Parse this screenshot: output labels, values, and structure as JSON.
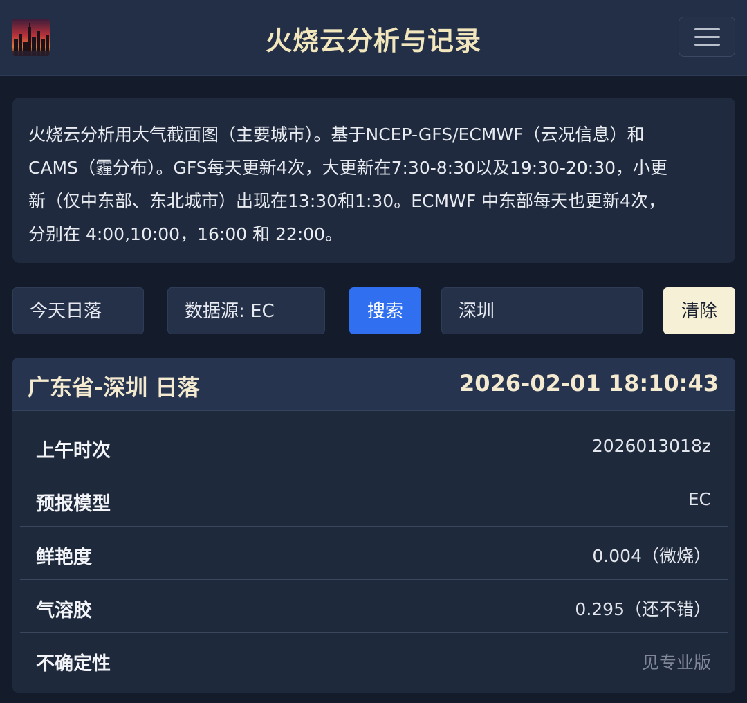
{
  "header": {
    "title": "火烧云分析与记录",
    "menu_icon": "hamburger-menu-icon",
    "logo_icon": "city-skyline-sunset-logo"
  },
  "description": {
    "line1": "火烧云分析用大气截面图（主要城市）。基于NCEP-GFS/ECMWF（云况信息）和",
    "line2": "CAMS（霾分布）。GFS每天更新4次，大更新在7:30-8:30以及19:30-20:30，小更",
    "line3": "新（仅中东部、东北城市）出现在13:30和1:30。ECMWF 中东部每天也更新4次，",
    "line4": "分别在 4:00,10:00，16:00 和 22:00。"
  },
  "controls": {
    "event_select": "今天日落",
    "source_select": "数据源: EC",
    "search_button": "搜索",
    "city_input_value": "深圳",
    "clear_button": "清除"
  },
  "result": {
    "title": "广东省-深圳 日落",
    "timestamp": "2026-02-01 18:10:43",
    "rows": [
      {
        "label": "上午时次",
        "value": "2026013018z"
      },
      {
        "label": "预报模型",
        "value": "EC"
      },
      {
        "label": "鲜艳度",
        "value": "0.004（微烧）"
      },
      {
        "label": "气溶胶",
        "value": "0.295（还不错）"
      },
      {
        "label": "不确定性",
        "value": "见专业版"
      }
    ]
  },
  "colors": {
    "background": "#141c2b",
    "header_bg": "#222f47",
    "title_gold": "#f2e6bd",
    "search_blue": "#2f6ff0",
    "clear_cream": "#f6f0d6"
  }
}
